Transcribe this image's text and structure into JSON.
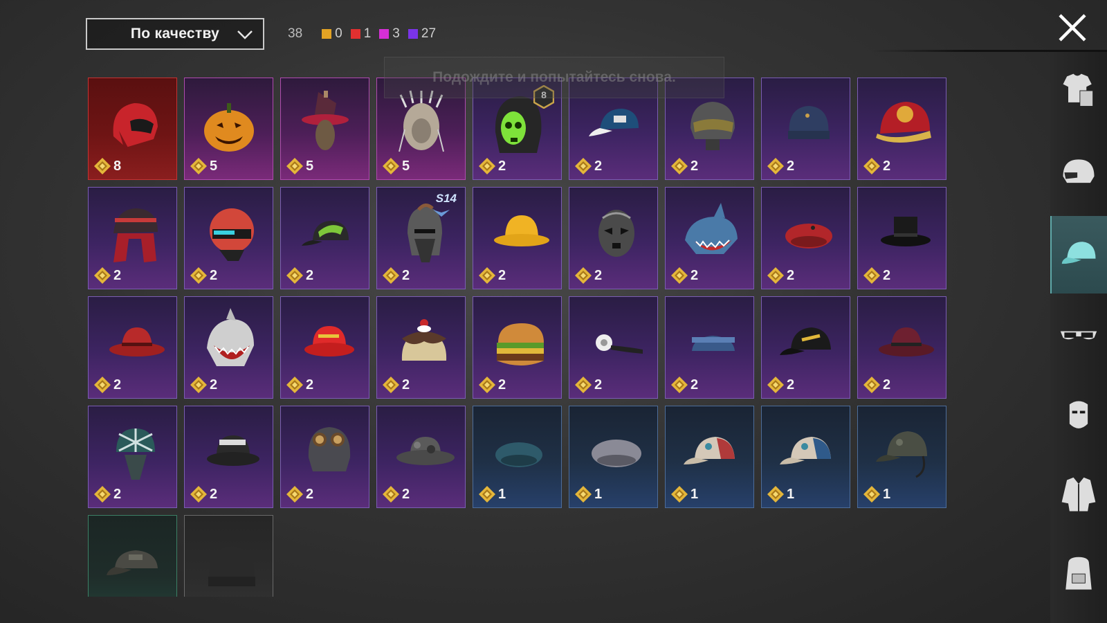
{
  "toolbar": {
    "sort_label": "По качеству",
    "total_count": "38",
    "legend": [
      {
        "color": "#e2a224",
        "count": "0"
      },
      {
        "color": "#e23030",
        "count": "1"
      },
      {
        "color": "#d62fd6",
        "count": "3"
      },
      {
        "color": "#7a34e8",
        "count": "27"
      }
    ]
  },
  "toast": {
    "message": "Подождите и попытайтесь снова."
  },
  "items": [
    {
      "icon": "red-helmet-icon",
      "rarity": "red",
      "cost": "8"
    },
    {
      "icon": "pumpkin-icon",
      "rarity": "pink",
      "cost": "5"
    },
    {
      "icon": "witch-hat-icon",
      "rarity": "pink",
      "cost": "5"
    },
    {
      "icon": "lion-mask-icon",
      "rarity": "pink",
      "cost": "5"
    },
    {
      "icon": "skull-hood-icon",
      "rarity": "purple",
      "cost": "2",
      "level_badge": "8"
    },
    {
      "icon": "baseball-cap-icon",
      "rarity": "purple",
      "cost": "2"
    },
    {
      "icon": "visor-helmet-icon",
      "rarity": "purple",
      "cost": "2"
    },
    {
      "icon": "beanie-icon",
      "rarity": "purple",
      "cost": "2"
    },
    {
      "icon": "gold-cap-icon",
      "rarity": "purple",
      "cost": "2"
    },
    {
      "icon": "bucket-hat-hair-icon",
      "rarity": "purple",
      "cost": "2"
    },
    {
      "icon": "racing-helmet-icon",
      "rarity": "purple",
      "cost": "2"
    },
    {
      "icon": "green-cap-icon",
      "rarity": "purple",
      "cost": "2"
    },
    {
      "icon": "knight-helmet-icon",
      "rarity": "purple",
      "cost": "2",
      "season_badge": "S14"
    },
    {
      "icon": "yellow-hat-icon",
      "rarity": "purple",
      "cost": "2"
    },
    {
      "icon": "luchador-mask-icon",
      "rarity": "purple",
      "cost": "2"
    },
    {
      "icon": "shark-hat-icon",
      "rarity": "purple",
      "cost": "2"
    },
    {
      "icon": "red-beret-icon",
      "rarity": "purple",
      "cost": "2"
    },
    {
      "icon": "top-hat-icon",
      "rarity": "purple",
      "cost": "2"
    },
    {
      "icon": "red-fedora-icon",
      "rarity": "purple",
      "cost": "2"
    },
    {
      "icon": "shark-mask-icon",
      "rarity": "purple",
      "cost": "2"
    },
    {
      "icon": "red-bucket-hat-icon",
      "rarity": "purple",
      "cost": "2"
    },
    {
      "icon": "pudding-hat-icon",
      "rarity": "purple",
      "cost": "2"
    },
    {
      "icon": "burger-hat-icon",
      "rarity": "purple",
      "cost": "2"
    },
    {
      "icon": "head-mirror-icon",
      "rarity": "purple",
      "cost": "2"
    },
    {
      "icon": "garrison-cap-icon",
      "rarity": "purple",
      "cost": "2"
    },
    {
      "icon": "black-cap-icon",
      "rarity": "purple",
      "cost": "2"
    },
    {
      "icon": "maroon-fedora-icon",
      "rarity": "purple",
      "cost": "2"
    },
    {
      "icon": "net-helmet-icon",
      "rarity": "purple",
      "cost": "2"
    },
    {
      "icon": "camo-bucket-hat-icon",
      "rarity": "purple",
      "cost": "2"
    },
    {
      "icon": "aviator-cap-icon",
      "rarity": "purple",
      "cost": "2"
    },
    {
      "icon": "camo-boonie-icon",
      "rarity": "purple",
      "cost": "2"
    },
    {
      "icon": "teal-beret-icon",
      "rarity": "blue",
      "cost": "1"
    },
    {
      "icon": "grey-beret-icon",
      "rarity": "blue",
      "cost": "1"
    },
    {
      "icon": "red-panel-cap-icon",
      "rarity": "blue",
      "cost": "1"
    },
    {
      "icon": "blue-panel-cap-icon",
      "rarity": "blue",
      "cost": "1"
    },
    {
      "icon": "camo-cap-headset-icon",
      "rarity": "blue",
      "cost": "1"
    },
    {
      "icon": "patrol-cap-icon",
      "rarity": "green",
      "cost": ""
    },
    {
      "icon": "black-beanie-icon",
      "rarity": "grey",
      "cost": ""
    }
  ],
  "sidebar": [
    {
      "icon": "outfit-icon",
      "active": false
    },
    {
      "icon": "helmet-icon",
      "active": false
    },
    {
      "icon": "cap-icon",
      "active": true
    },
    {
      "icon": "glasses-icon",
      "active": false
    },
    {
      "icon": "mask-icon",
      "active": false
    },
    {
      "icon": "jacket-icon",
      "active": false
    },
    {
      "icon": "backpack-icon",
      "active": false
    }
  ]
}
